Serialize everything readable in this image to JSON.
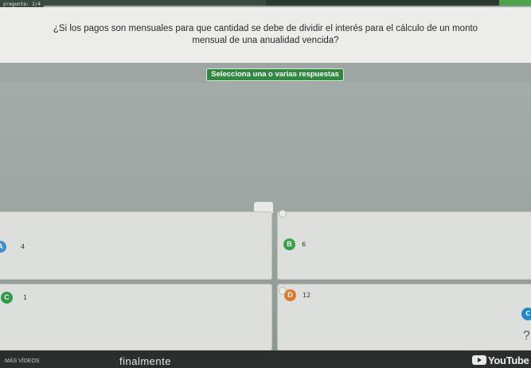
{
  "progress": {
    "counter": "pregunta: 2/4",
    "fraction": 0.5
  },
  "question": {
    "text": "¿Si los pagos son mensuales para que cantidad se debe de dividir el interés para el cálculo de un monto mensual de una anualidad vencida?"
  },
  "instruction": "Selecciona una o varias respuestas",
  "answers": [
    {
      "letter": "A",
      "value": "4",
      "color": "#3f8fd2"
    },
    {
      "letter": "B",
      "value": "6",
      "color": "#37a148"
    },
    {
      "letter": "C",
      "value": "1",
      "color": "#2e9a47"
    },
    {
      "letter": "D",
      "value": "12",
      "color": "#e07a2c"
    }
  ],
  "overlay": {
    "more_videos": "MÁS VÍDEOS",
    "caption": "finalmente",
    "youtube": "YouTube",
    "side_button": "C",
    "help": "?"
  },
  "colors": {
    "accent_green": "#2f8a3f",
    "background": "#a3aaa8"
  }
}
